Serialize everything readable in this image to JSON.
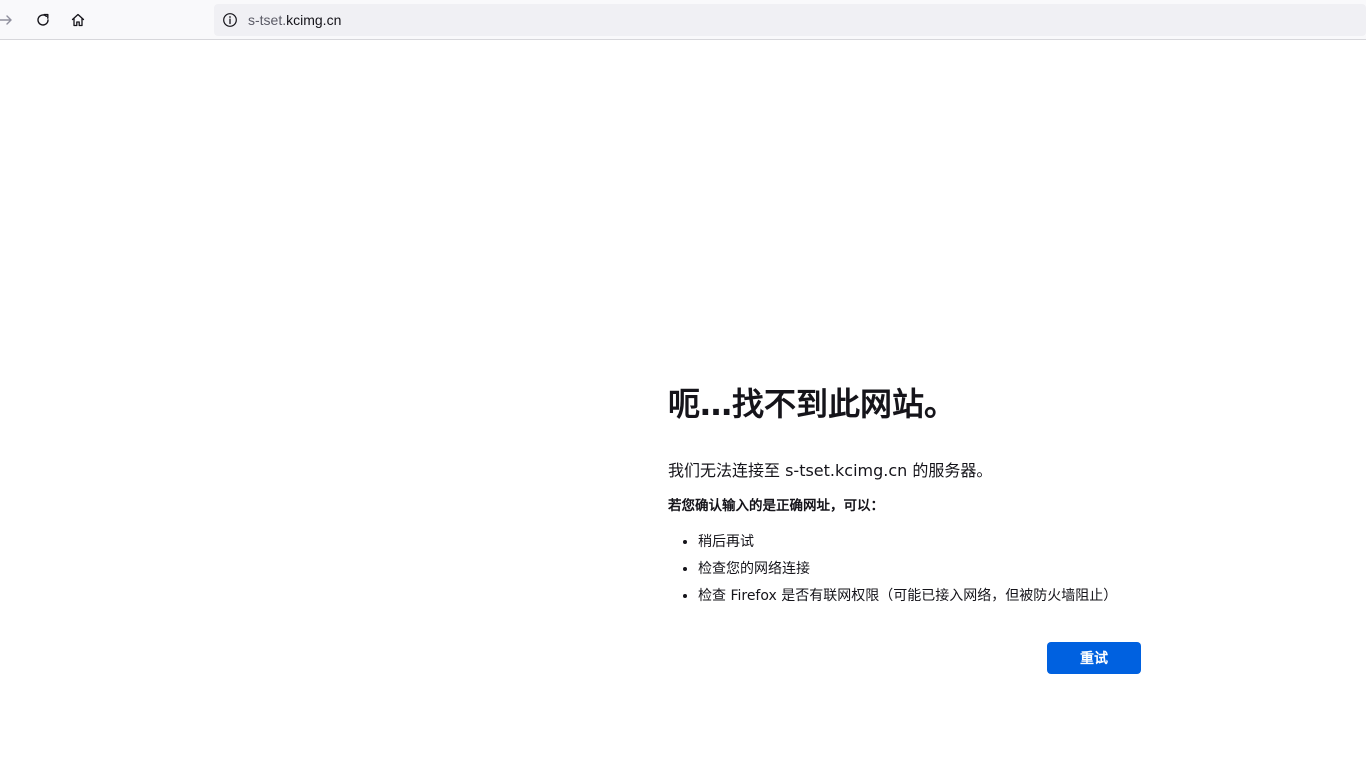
{
  "browser": {
    "url_prefix": "s-tset.",
    "url_domain": "kcimg.cn",
    "icons": {
      "forward": "arrow-right-icon",
      "reload": "reload-icon",
      "home": "home-icon",
      "site_info": "info-icon"
    }
  },
  "error_page": {
    "title": "呃…找不到此网站。",
    "description": "我们无法连接至 s-tset.kcimg.cn 的服务器。",
    "subheading": "若您确认输入的是正确网址，可以：",
    "tips": [
      "稍后再试",
      "检查您的网络连接",
      "检查 Firefox 是否有联网权限（可能已接入网络，但被防火墙阻止）"
    ],
    "retry_label": "重试"
  },
  "colors": {
    "accent": "#0061e0",
    "text": "#15141a",
    "urlbar_bg": "#f0f0f4"
  }
}
